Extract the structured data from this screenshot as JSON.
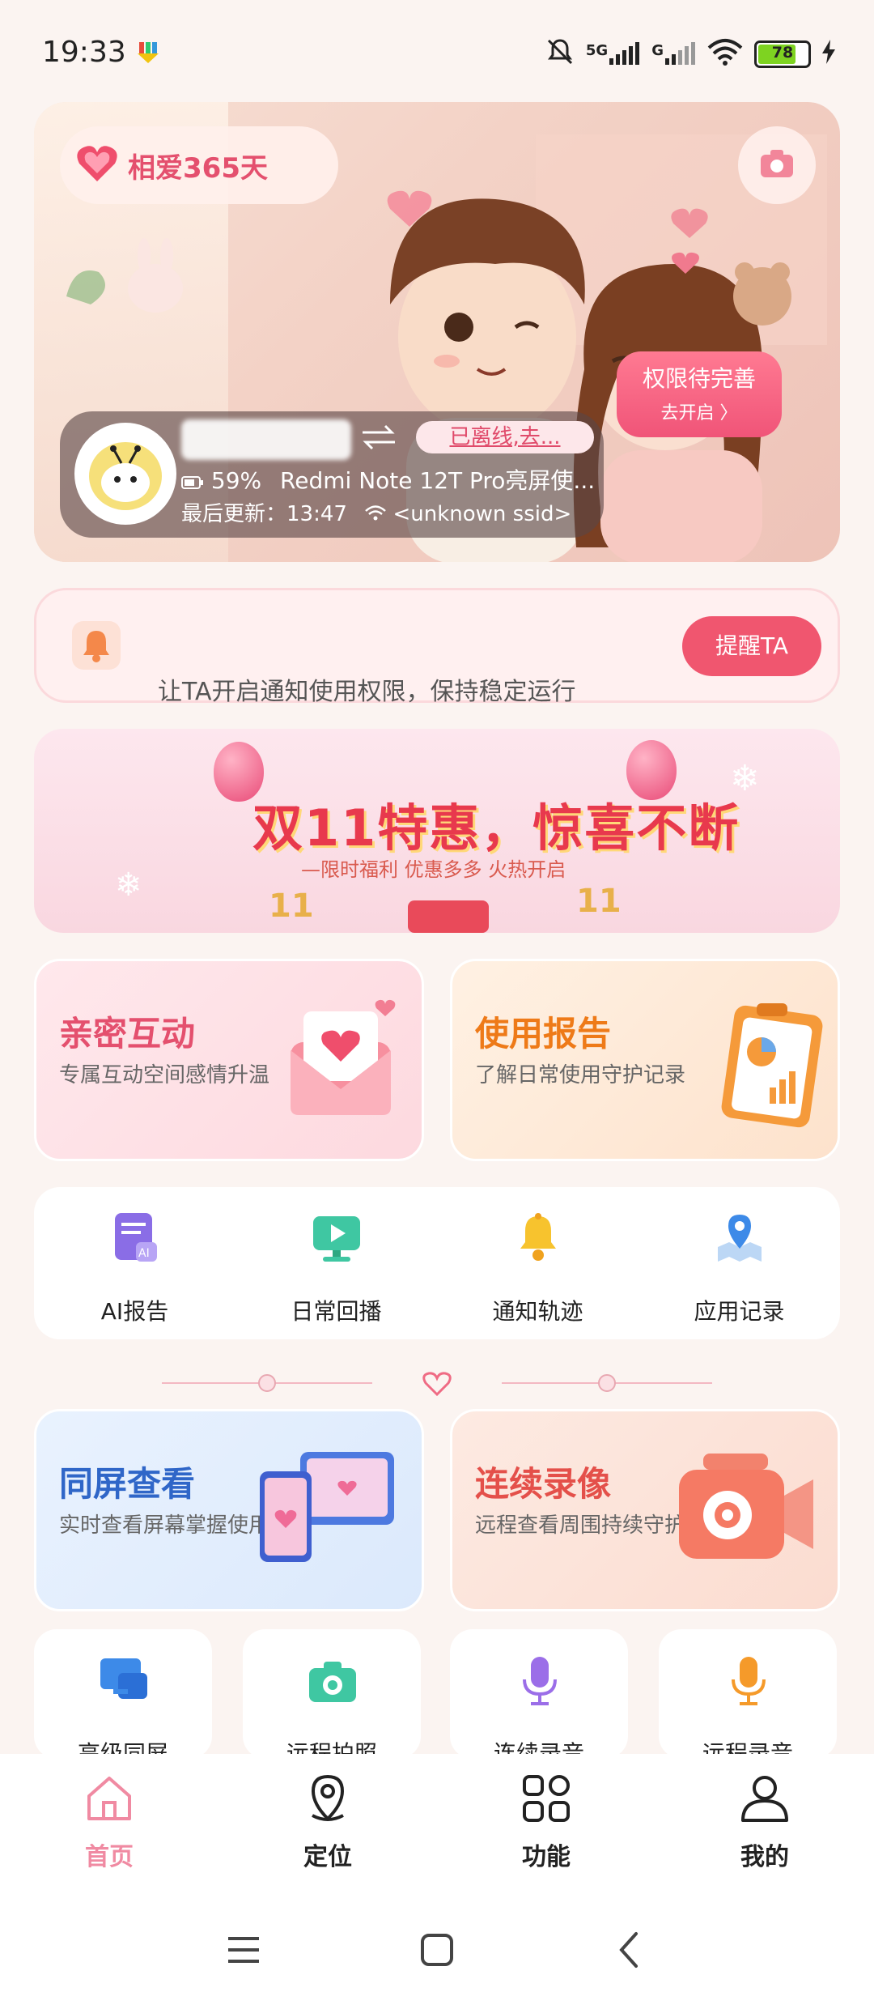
{
  "status_bar": {
    "time": "19:33",
    "network_1": "5G",
    "network_2": "G",
    "battery": "78",
    "battery_level_percent": 78
  },
  "hero": {
    "couple_label": "相爱365天",
    "device_status": "已离线,去...",
    "battery_percent": "59%",
    "device_name": "Redmi Note 12T Pro亮屏使...",
    "last_update": "最后更新：13:47",
    "wifi_ssid": "<unknown ssid>",
    "permission_title": "权限待完善",
    "permission_action": "去开启 〉"
  },
  "notification": {
    "text": "让TA开启通知使用权限，保持稳定运行",
    "button": "提醒TA"
  },
  "promo": {
    "title": "双11特惠，惊喜不断",
    "subtitle": "—限时福利  优惠多多  火热开启",
    "deco_left": "11",
    "deco_right": "11"
  },
  "feature_cards": [
    {
      "title": "亲密互动",
      "desc": "专属互动空间感情升温",
      "color": "#e4506e"
    },
    {
      "title": "使用报告",
      "desc": "了解日常使用守护记录",
      "color": "#ee7a18"
    }
  ],
  "quick_grid": [
    {
      "label": "AI报告",
      "icon": "ai-report-icon"
    },
    {
      "label": "日常回播",
      "icon": "playback-icon"
    },
    {
      "label": "通知轨迹",
      "icon": "bell-icon"
    },
    {
      "label": "应用记录",
      "icon": "location-map-icon"
    }
  ],
  "feature_cards_2": [
    {
      "title": "同屏查看",
      "desc": "实时查看屏幕掌握使用",
      "color": "#2f66c8"
    },
    {
      "title": "连续录像",
      "desc": "远程查看周围持续守护",
      "color": "#e4504a"
    }
  ],
  "tiles": [
    {
      "label": "高级同屏",
      "icon": "screen-share-icon"
    },
    {
      "label": "远程拍照",
      "icon": "camera-icon"
    },
    {
      "label": "连续录音",
      "icon": "microphone-icon"
    },
    {
      "label": "远程录音",
      "icon": "microphone-icon"
    }
  ],
  "bottom_nav": [
    {
      "label": "首页",
      "icon": "home-icon",
      "active": true
    },
    {
      "label": "定位",
      "icon": "location-pin-icon",
      "active": false
    },
    {
      "label": "功能",
      "icon": "grid-icon",
      "active": false
    },
    {
      "label": "我的",
      "icon": "user-icon",
      "active": false
    }
  ],
  "colors": {
    "accent_pink": "#f0566f",
    "active_nav": "#f08aa2",
    "background": "#fbf4f1"
  }
}
